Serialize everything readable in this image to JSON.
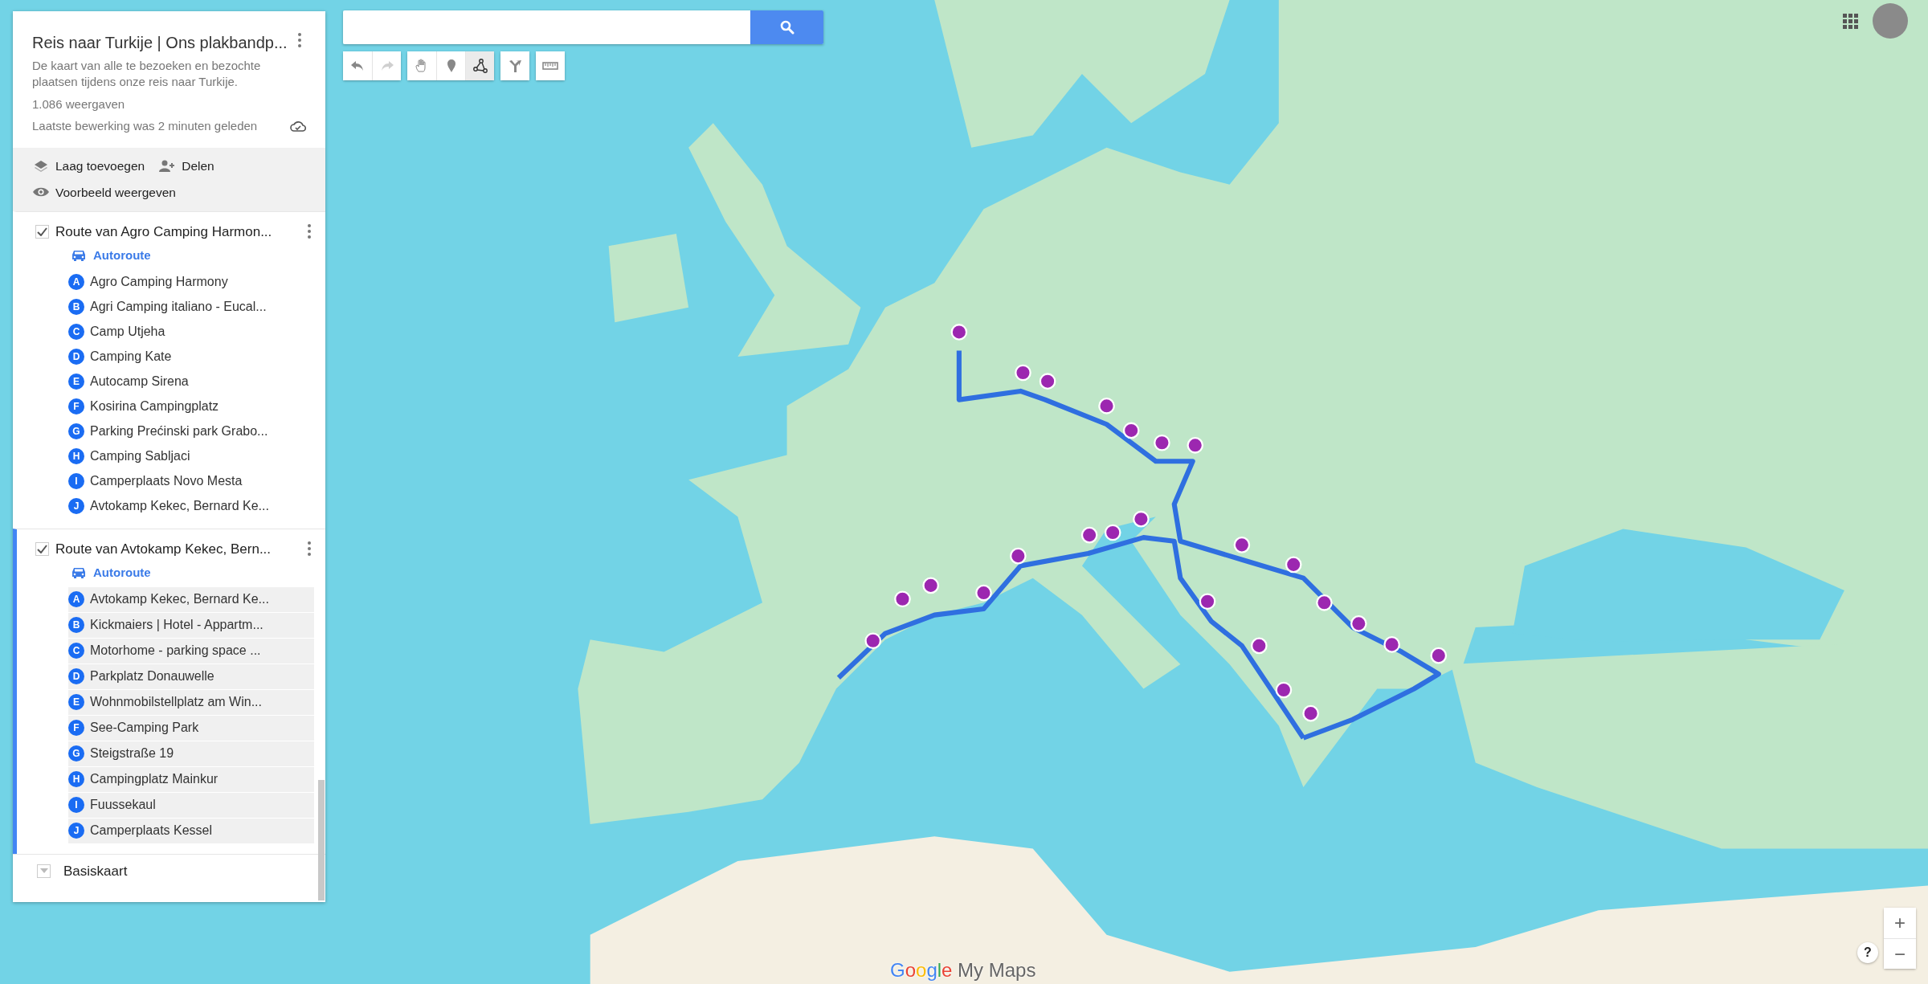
{
  "map_panel": {
    "title": "Reis naar Turkije | Ons plakbandp...",
    "description": "De kaart van alle te bezoeken en bezochte plaatsen tijdens onze reis naar Turkije.",
    "views": "1.086 weergaven",
    "last_edit": "Laatste bewerking was 2 minuten geleden",
    "actions": [
      {
        "kind": "layer",
        "label": "Laag toevoegen"
      },
      {
        "kind": "share",
        "label": "Delen"
      },
      {
        "kind": "preview",
        "label": "Voorbeeld weergeven"
      }
    ],
    "layers": [
      {
        "title": "Route van Agro Camping Harmon...",
        "checked": true,
        "selected": false,
        "route_type": "Autoroute",
        "stops": [
          {
            "letter": "A",
            "name": "Agro Camping Harmony"
          },
          {
            "letter": "B",
            "name": "Agri Camping italiano - Eucal..."
          },
          {
            "letter": "C",
            "name": "Camp Utjeha"
          },
          {
            "letter": "D",
            "name": "Camping Kate"
          },
          {
            "letter": "E",
            "name": "Autocamp Sirena"
          },
          {
            "letter": "F",
            "name": "Kosirina Campingplatz"
          },
          {
            "letter": "G",
            "name": "Parking Prećinski park Grabo..."
          },
          {
            "letter": "H",
            "name": "Camping Sabljaci"
          },
          {
            "letter": "I",
            "name": "Camperplaats Novo Mesta"
          },
          {
            "letter": "J",
            "name": "Avtokamp Kekec, Bernard Ke..."
          }
        ]
      },
      {
        "title": "Route van Avtokamp Kekec, Bern...",
        "checked": true,
        "selected": true,
        "route_type": "Autoroute",
        "stops": [
          {
            "letter": "A",
            "name": "Avtokamp Kekec, Bernard Ke..."
          },
          {
            "letter": "B",
            "name": "Kickmaiers | Hotel - Appartm..."
          },
          {
            "letter": "C",
            "name": "Motorhome - parking space ..."
          },
          {
            "letter": "D",
            "name": "Parkplatz Donauwelle"
          },
          {
            "letter": "E",
            "name": "Wohnmobilstellplatz am Win..."
          },
          {
            "letter": "F",
            "name": "See-Camping Park"
          },
          {
            "letter": "G",
            "name": "Steigstraße 19"
          },
          {
            "letter": "H",
            "name": "Campingplatz Mainkur"
          },
          {
            "letter": "I",
            "name": "Fuussekaul"
          },
          {
            "letter": "J",
            "name": "Camperplaats Kessel"
          }
        ]
      }
    ],
    "base_map": {
      "label": "Basiskaart",
      "expanded": false
    }
  },
  "toolbar": [
    {
      "kind": "undo",
      "selected": false,
      "disabled": false
    },
    {
      "kind": "redo",
      "selected": false,
      "disabled": true
    },
    {
      "kind": "pan",
      "selected": false,
      "disabled": false
    },
    {
      "kind": "marker",
      "selected": false,
      "disabled": false
    },
    {
      "kind": "line",
      "selected": true,
      "disabled": false
    },
    {
      "kind": "directions",
      "selected": false,
      "disabled": false
    },
    {
      "kind": "measure",
      "selected": false,
      "disabled": false
    }
  ],
  "zoom_controls": [
    "+",
    "−"
  ],
  "help": "?",
  "logo": {
    "brand": "Google",
    "product": "My Maps"
  }
}
